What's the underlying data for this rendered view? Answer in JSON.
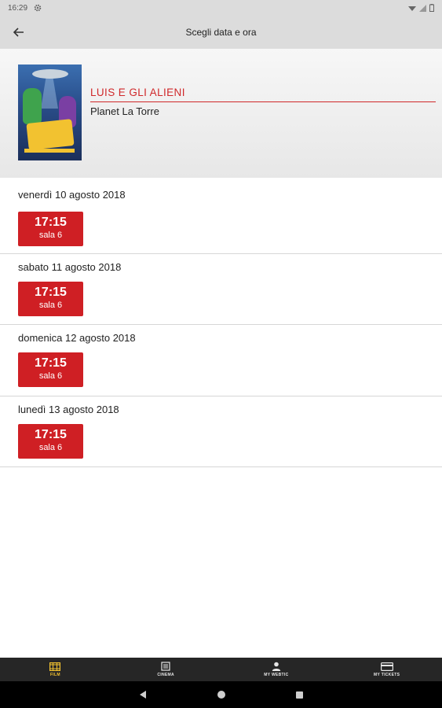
{
  "status": {
    "time": "16:29"
  },
  "header": {
    "title": "Scegli data e ora"
  },
  "movie": {
    "title": "LUIS E GLI ALIENI",
    "cinema": "Planet La Torre"
  },
  "days": [
    {
      "date": "venerdì 10 agosto 2018",
      "shows": [
        {
          "time": "17:15",
          "room": "sala 6"
        }
      ]
    },
    {
      "date": "sabato 11 agosto 2018",
      "shows": [
        {
          "time": "17:15",
          "room": "sala 6"
        }
      ]
    },
    {
      "date": "domenica 12 agosto 2018",
      "shows": [
        {
          "time": "17:15",
          "room": "sala 6"
        }
      ]
    },
    {
      "date": "lunedì 13 agosto 2018",
      "shows": [
        {
          "time": "17:15",
          "room": "sala 6"
        }
      ]
    }
  ],
  "nav": [
    {
      "label": "FILM",
      "icon": "film-icon",
      "active": true
    },
    {
      "label": "CINEMA",
      "icon": "cinema-icon",
      "active": false
    },
    {
      "label": "MY WEBTIC",
      "icon": "person-icon",
      "active": false
    },
    {
      "label": "MY TICKETS",
      "icon": "ticket-card-icon",
      "active": false
    }
  ],
  "colors": {
    "accent": "#cf1f24",
    "nav_active": "#f2c230",
    "app_bar": "#dcdcdc"
  }
}
